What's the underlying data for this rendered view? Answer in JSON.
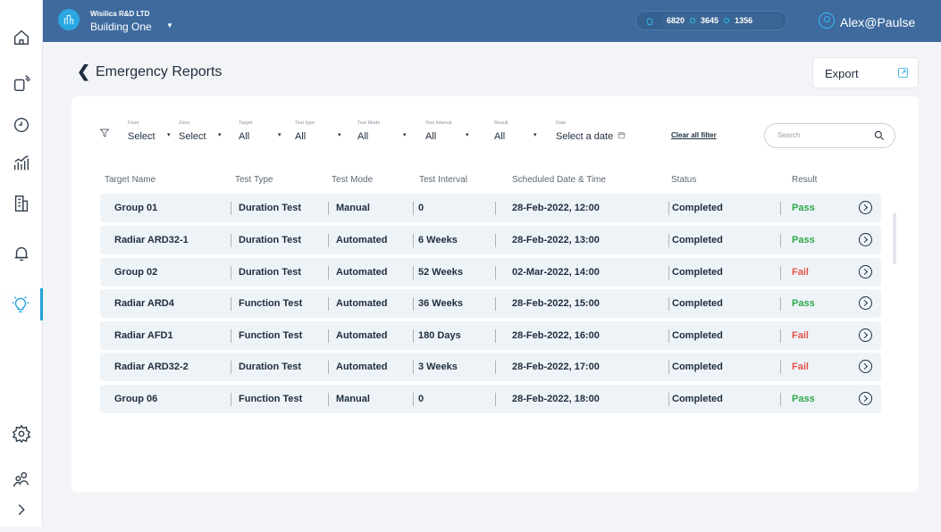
{
  "header": {
    "org_name": "Wisilica R&D LTD",
    "building": "Building One",
    "counts": [
      "6820",
      "3645",
      "1356"
    ],
    "user": "Alex@Paulse"
  },
  "sidebar": {
    "icons": [
      "home-icon",
      "devices-icon",
      "clock-icon",
      "analytics-icon",
      "building-icon",
      "bell-icon",
      "lightbulb-icon",
      "gear-icon",
      "users-icon",
      "chevron-right-icon"
    ],
    "active": "lightbulb-icon"
  },
  "page": {
    "title": "Emergency Reports",
    "export_label": "Export"
  },
  "filters": [
    {
      "label": "Floor",
      "value": "Select"
    },
    {
      "label": "Zone",
      "value": "Select"
    },
    {
      "label": "Target",
      "value": "All"
    },
    {
      "label": "Test type",
      "value": "All"
    },
    {
      "label": "Test Mode",
      "value": "All"
    },
    {
      "label": "Test Interval",
      "value": "All"
    },
    {
      "label": "Result",
      "value": "All"
    },
    {
      "label": "Date",
      "value": "Select a date"
    }
  ],
  "clear_filter": "Clear all filter",
  "search": {
    "placeholder": "Search"
  },
  "table": {
    "columns": [
      "Target Name",
      "Test Type",
      "Test Mode",
      "Test Interval",
      "Scheduled Date & Time",
      "Status",
      "Result"
    ],
    "rows": [
      [
        "Group 01",
        "Duration Test",
        "Manual",
        "0",
        "28-Feb-2022, 12:00",
        "Completed",
        "Pass"
      ],
      [
        "Radiar ARD32-1",
        "Duration Test",
        "Automated",
        "6 Weeks",
        "28-Feb-2022, 13:00",
        "Completed",
        "Pass"
      ],
      [
        "Group 02",
        "Duration Test",
        "Automated",
        "52 Weeks",
        "02-Mar-2022, 14:00",
        "Completed",
        "Fail"
      ],
      [
        "Radiar ARD4",
        "Function Test",
        "Automated",
        "36 Weeks",
        "28-Feb-2022, 15:00",
        "Completed",
        "Pass"
      ],
      [
        "Radiar AFD1",
        "Function Test",
        "Automated",
        "180 Days",
        "28-Feb-2022, 16:00",
        "Completed",
        "Fail"
      ],
      [
        "Radiar ARD32-2",
        "Duration Test",
        "Automated",
        "3 Weeks",
        "28-Feb-2022, 17:00",
        "Completed",
        "Fail"
      ],
      [
        "Group 06",
        "Function Test",
        "Manual",
        "0",
        "28-Feb-2022, 18:00",
        "Completed",
        "Pass"
      ]
    ]
  },
  "colors": {
    "header_bg": "#3e6a9e",
    "accent": "#23a3d9",
    "pass": "#2ea84a",
    "fail": "#e8524a",
    "row_bg": "#eef3f8"
  }
}
